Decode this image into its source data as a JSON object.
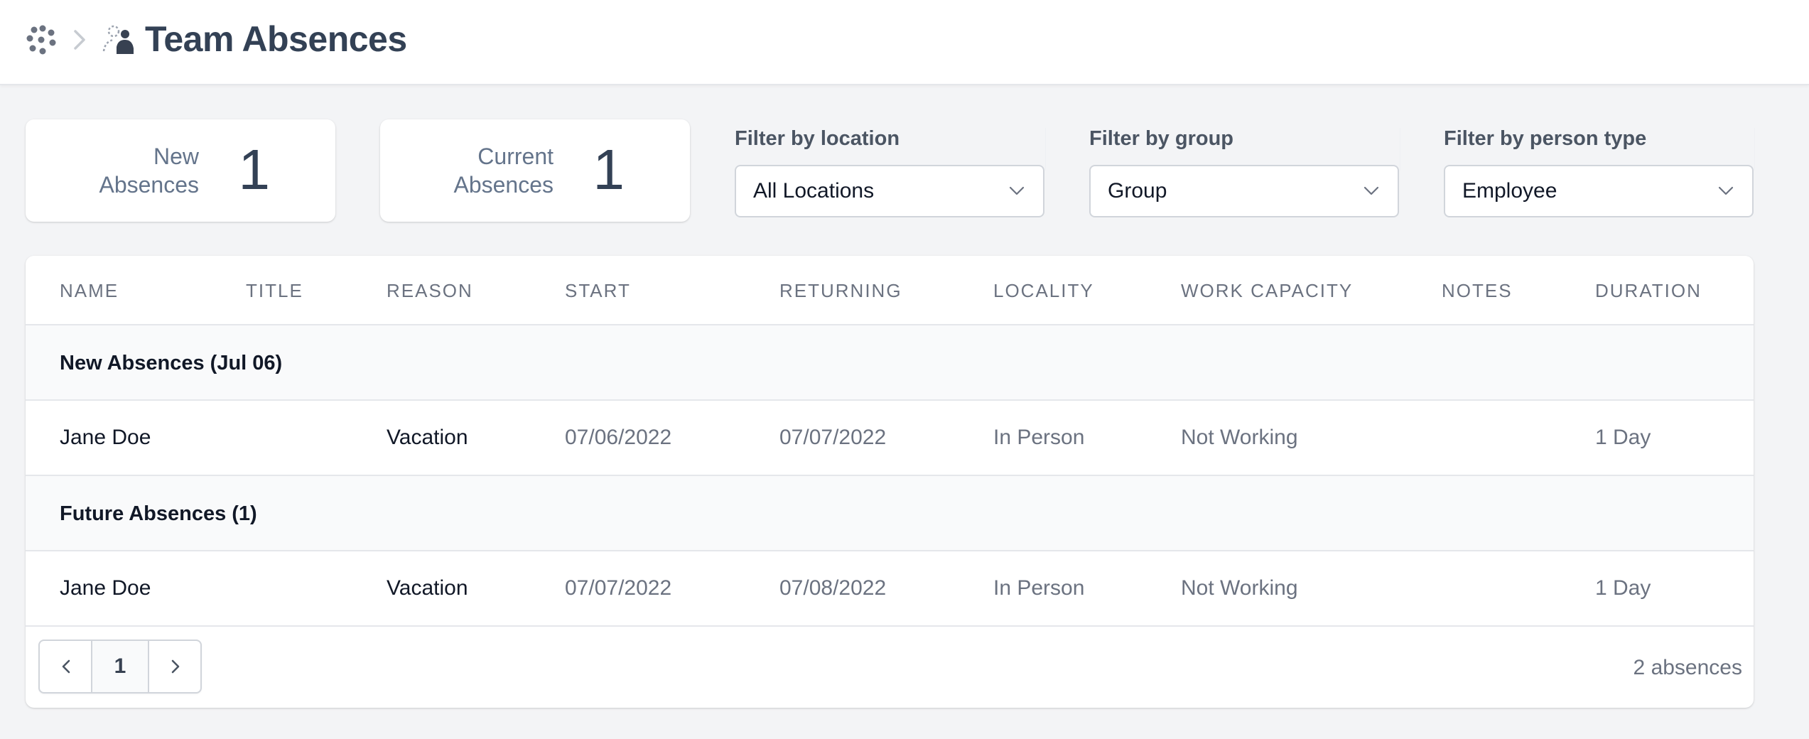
{
  "header": {
    "title": "Team Absences",
    "app_icon": "dots-grid-icon",
    "separator_icon": "chevron-right-icon",
    "page_icon": "person-absent-icon"
  },
  "stats": {
    "new": {
      "label_line1": "New",
      "label_line2": "Absences",
      "value": "1"
    },
    "current": {
      "label_line1": "Current",
      "label_line2": "Absences",
      "value": "1"
    }
  },
  "filters": {
    "location": {
      "label": "Filter by location",
      "value": "All Locations"
    },
    "group": {
      "label": "Filter by group",
      "value": "Group"
    },
    "person_type": {
      "label": "Filter by person type",
      "value": "Employee"
    }
  },
  "table": {
    "columns": [
      "NAME",
      "TITLE",
      "REASON",
      "START",
      "RETURNING",
      "LOCALITY",
      "WORK CAPACITY",
      "NOTES",
      "DURATION"
    ],
    "groups": [
      {
        "title": "New Absences (Jul 06)",
        "rows": [
          {
            "name": "Jane Doe",
            "title": "",
            "reason": "Vacation",
            "start": "07/06/2022",
            "returning": "07/07/2022",
            "locality": "In Person",
            "work_capacity": "Not Working",
            "notes": "",
            "duration": "1 Day"
          }
        ]
      },
      {
        "title": "Future Absences (1)",
        "rows": [
          {
            "name": "Jane Doe",
            "title": "",
            "reason": "Vacation",
            "start": "07/07/2022",
            "returning": "07/08/2022",
            "locality": "In Person",
            "work_capacity": "Not Working",
            "notes": "",
            "duration": "1 Day"
          }
        ]
      }
    ]
  },
  "pagination": {
    "current_page": "1",
    "total_label": "2 absences",
    "prev_icon": "chevron-left-icon",
    "next_icon": "chevron-right-icon"
  },
  "colors": {
    "background": "#f3f4f6",
    "card": "#ffffff",
    "title": "#334155",
    "muted_text": "#6b7280"
  }
}
